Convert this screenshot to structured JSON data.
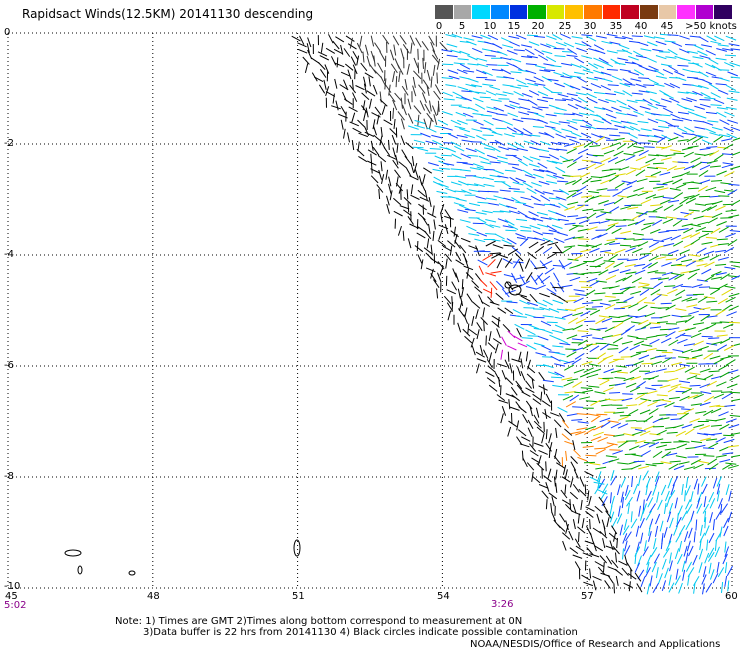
{
  "title": "Rapidsact Winds(12.5KM) 20141130 descending",
  "legend": {
    "swatches": [
      "#555555",
      "#a8a8a8",
      "#00d8ff",
      "#0088ff",
      "#0030e0",
      "#00b000",
      "#d8e800",
      "#ffc000",
      "#ff7a00",
      "#ff2a00",
      "#c00020",
      "#7a3a10",
      "#e8c8a8",
      "#ff30ff",
      "#b000d0",
      "#300060"
    ],
    "labels": [
      "0",
      "5",
      "10",
      "15",
      "20",
      "25",
      "30",
      "35",
      "40",
      "45",
      ">50 knots"
    ]
  },
  "axes": {
    "y_labels": [
      "0",
      "-2",
      "-4",
      "-6",
      "-8",
      "-10"
    ],
    "x_labels": [
      "45",
      "48",
      "51",
      "54",
      "57",
      "60"
    ],
    "y_values": [
      0,
      -2,
      -4,
      -6,
      -8,
      -10
    ],
    "x_values": [
      45,
      48,
      51,
      54,
      57,
      60
    ],
    "lat_range": [
      0,
      -10
    ],
    "lon_range": [
      45,
      60
    ],
    "grid": "dotted"
  },
  "times": {
    "left": "5:02",
    "mid": "3:26"
  },
  "notes": [
    "Note: 1) Times are GMT 2)Times along bottom correspond to measurement at 0N",
    "3)Data buffer is 22 hrs from 20141130 4) Black circles indicate possible contamination"
  ],
  "credit": "NOAA/NESDIS/Office of Research and Applications",
  "colors": {
    "dark_gray": "#333333",
    "cyan": "#00c8f0",
    "blue": "#1040ff",
    "green": "#00a000",
    "yellow": "#e0d800",
    "orange": "#ff8000",
    "red": "#ff2000",
    "magenta": "#d000d0",
    "black": "#000000"
  }
}
